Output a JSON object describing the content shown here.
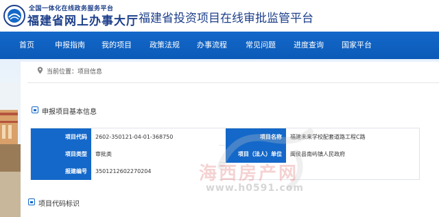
{
  "header": {
    "logo_top": "全国一体化在线政务服务平台",
    "logo_main": "福建省网上办事大厅",
    "platform_title": "福建省投资项目在线审批监管平台"
  },
  "nav": {
    "items": [
      "首页",
      "申报指南",
      "我的项目",
      "政策法规",
      "办事流程",
      "常见问题",
      "进度查询",
      "国家平台"
    ]
  },
  "breadcrumb": {
    "label": "当前位置：项目信息"
  },
  "section_basic": {
    "title": "申报项目基本信息",
    "rows": [
      {
        "label1": "项目代码",
        "value1": "2602-350121-04-01-368750",
        "label2": "项目名称",
        "value2": "福建未来学校配套道路工程C路"
      },
      {
        "label1": "项目类型",
        "value1": "审批类",
        "label2": "项目（法人）单位",
        "value2": "闽侯县南屿镇人民政府"
      },
      {
        "label1": "报建编号",
        "value1": "35012126022702​04",
        "label2": "",
        "value2": ""
      }
    ]
  },
  "section_code": {
    "title": "项目代码标识"
  },
  "watermark": {
    "text": "海西房产网",
    "url": "www.h0591.com"
  },
  "colors": {
    "nav_blue": "#1468c9",
    "label_blue": "#1468c9",
    "title_blue": "#1d3f8a"
  }
}
